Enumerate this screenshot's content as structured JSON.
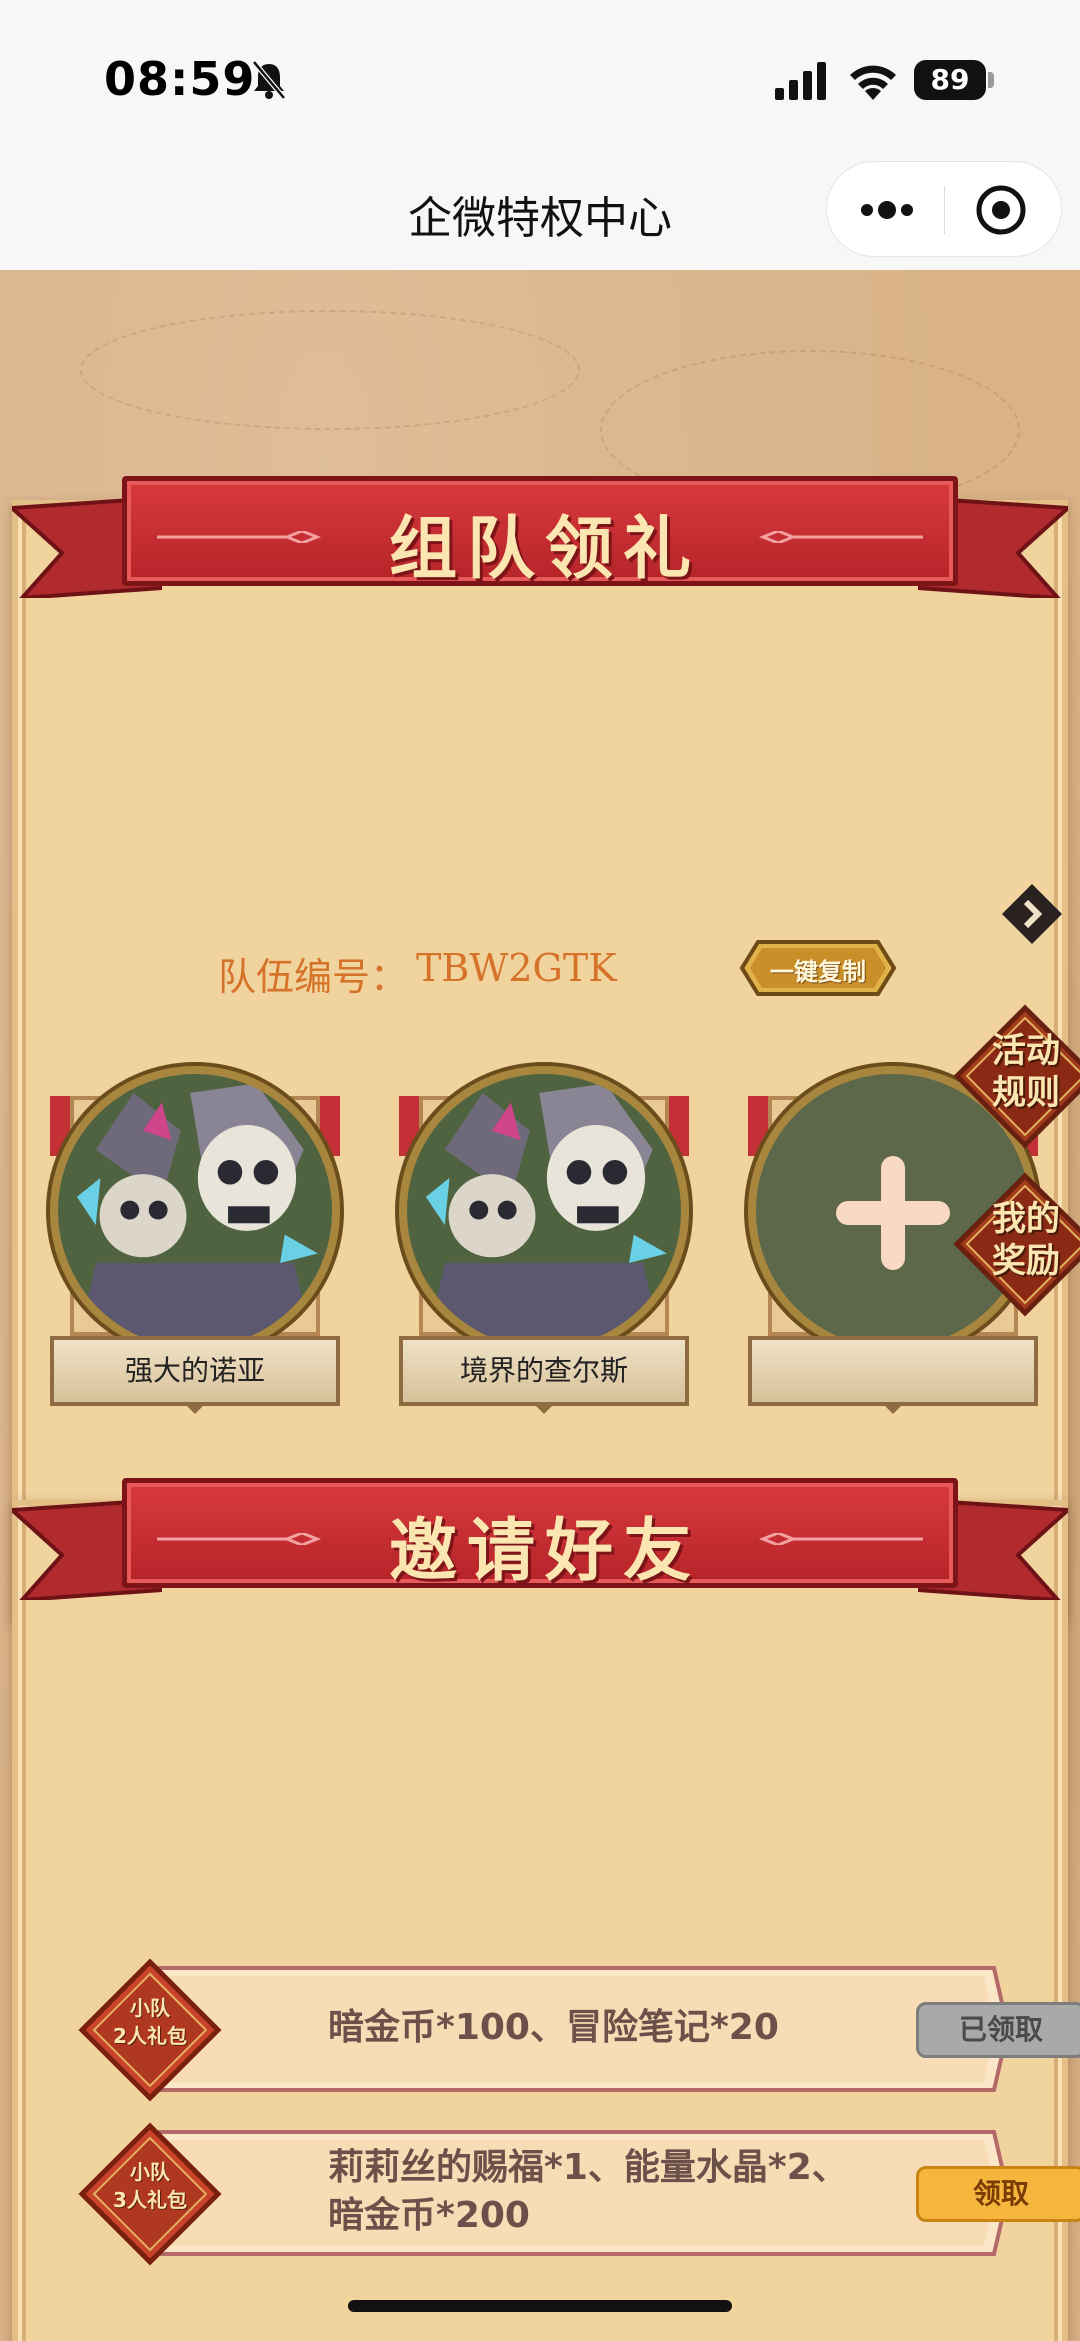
{
  "status_bar": {
    "time": "08:59",
    "battery": "89",
    "icons": [
      "bell-muted-icon",
      "signal-icon",
      "wifi-icon",
      "battery-icon"
    ]
  },
  "title_bar": {
    "title": "企微特权中心",
    "icons": [
      "more-icon",
      "target-icon"
    ]
  },
  "team_section": {
    "banner": "组队领礼",
    "team_label": "队伍编号：",
    "team_code": "TBW2GTK",
    "copy_button": "一键复制",
    "rules_badge": [
      "活动",
      "规则"
    ],
    "rewards_badge": [
      "我的",
      "奖励"
    ],
    "members": [
      {
        "name": "强大的诺亚"
      },
      {
        "name": "境界的查尔斯"
      },
      {
        "name": ""
      }
    ]
  },
  "invite_section": {
    "banner": "邀请好友",
    "rewards": [
      {
        "badge": [
          "小队",
          "2人礼包"
        ],
        "text_lines": [
          "暗金币*100、冒险笔记*20"
        ],
        "button": "已领取",
        "status": "claimed"
      },
      {
        "badge": [
          "小队",
          "3人礼包"
        ],
        "text_lines": [
          "莉莉丝的赐福*1、能量水晶*2、",
          "暗金币*200"
        ],
        "button": "领取",
        "status": "available"
      }
    ]
  },
  "colors": {
    "banner_red": "#c62f34",
    "team_text": "#d6732a",
    "claim_button": "#f6b53d",
    "claimed_button": "#a9a9a9"
  }
}
